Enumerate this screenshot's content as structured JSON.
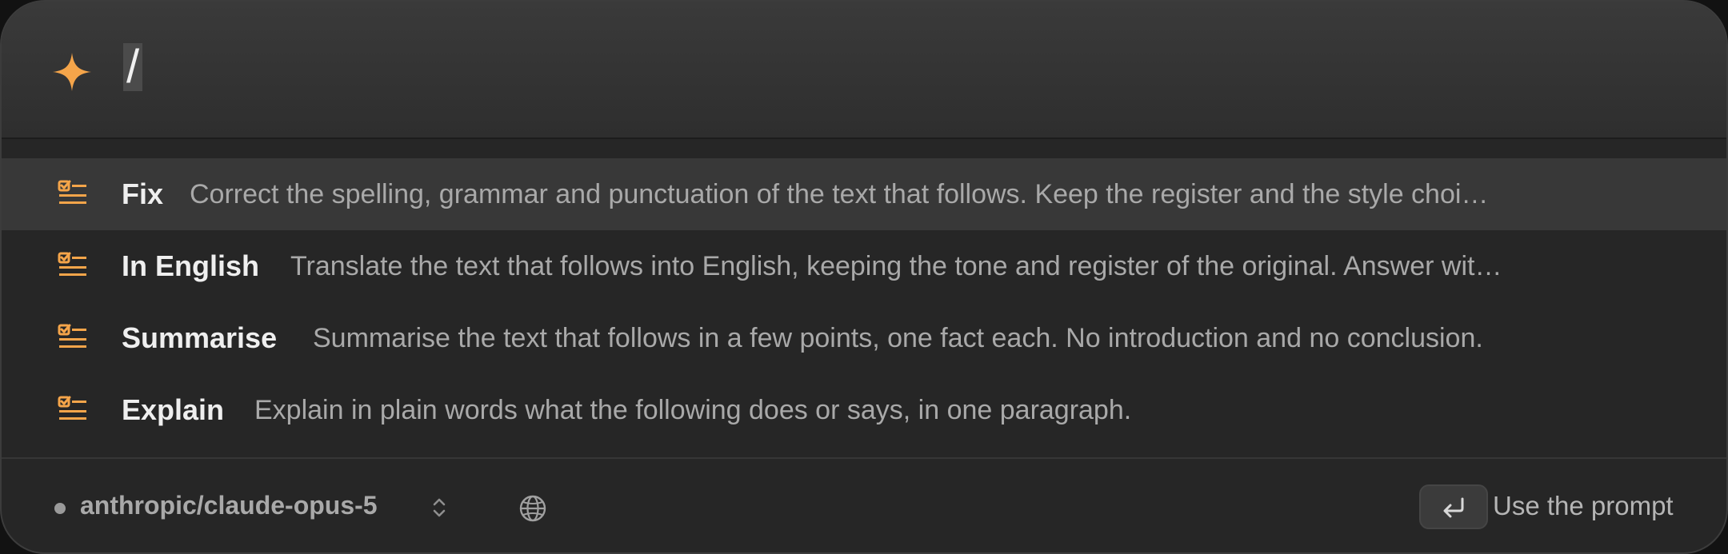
{
  "search": {
    "query": "/"
  },
  "prompts": [
    {
      "title": "Fix",
      "description": "Correct the spelling, grammar and punctuation of the text that follows. Keep the register and the style choi…",
      "icon": "checklist-icon",
      "selected": true
    },
    {
      "title": "In English",
      "description": "Translate the text that follows into English, keeping the tone and register of the original. Answer wit…",
      "icon": "checklist-icon",
      "selected": false
    },
    {
      "title": "Summarise",
      "description": "Summarise the text that follows in a few points, one fact each. No introduction and no conclusion.",
      "icon": "checklist-icon",
      "selected": false
    },
    {
      "title": "Explain",
      "description": "Explain in plain words what the following does or says, in one paragraph.",
      "icon": "checklist-icon",
      "selected": false
    }
  ],
  "footer": {
    "model": "anthropic/claude-opus-5",
    "action_label": "Use the prompt",
    "action_icon": "return-key-icon"
  },
  "colors": {
    "accent": "#f5a54a",
    "background": "#262626",
    "selected_row": "#383838"
  }
}
